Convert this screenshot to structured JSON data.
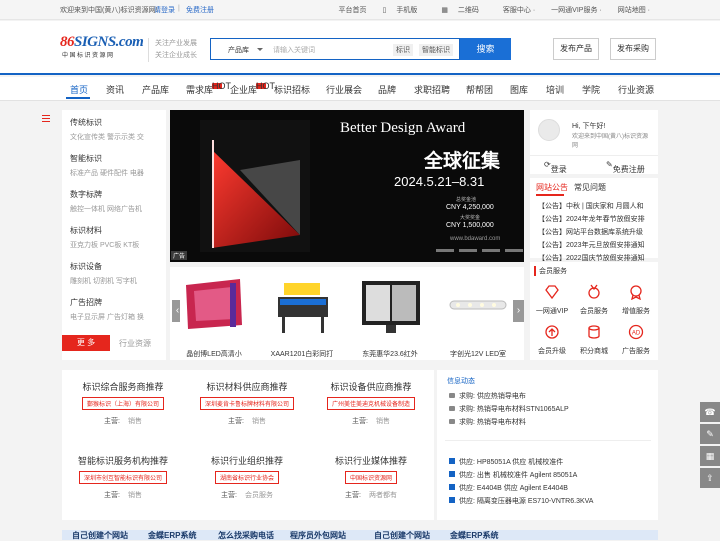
{
  "topbar": {
    "welcome": "欢迎来到中国(黄八)标识资源网!",
    "login": "请登录",
    "sep": "|",
    "register": "免费注册",
    "links": [
      "平台首页",
      "手机版",
      "二维码",
      "客服中心 ·",
      "一网通VIP服务 ·",
      "网站地图 ·"
    ]
  },
  "header": {
    "logo_text": "SIGNS.com",
    "logo_prefix": "86",
    "logo_sub": "中国标识资源网",
    "slogan": [
      "关注产业发展",
      "关注企业成长"
    ],
    "search": {
      "category": "产品库",
      "placeholder": "请输入关键词",
      "tag1": "标识",
      "tag2": "智能标识",
      "button": "搜索"
    },
    "publish_product": "发布产品",
    "publish_purchase": "发布采购"
  },
  "nav": {
    "items": [
      "首页",
      "资讯",
      "产品库",
      "需求库",
      "企业库",
      "标识招标",
      "行业展会",
      "品牌",
      "求职招聘",
      "帮帮团",
      "图库",
      "培训",
      "学院",
      "行业资源"
    ],
    "hot_label": "HOT"
  },
  "categories": {
    "groups": [
      {
        "title": "传统标识",
        "sub": "文化宣传类  警示示类  交"
      },
      {
        "title": "智能标识",
        "sub": "标准产品  硬件配件  电器"
      },
      {
        "title": "数字标牌",
        "sub": "触控一体机  网络广告机"
      },
      {
        "title": "标识材料",
        "sub": "亚克力板  PVC板  KT板"
      },
      {
        "title": "标识设备",
        "sub": "雕刻机  切割机  写字机"
      },
      {
        "title": "广告招牌",
        "sub": "电子显示屏  广告灯箱  换"
      }
    ],
    "more": "更  多",
    "resources": "行业资源"
  },
  "banner": {
    "line1": "Better Design Award",
    "line2": "全球征集",
    "line3": "2024.5.21–8.31",
    "prize1_label": "总奖金池",
    "prize1": "CNY 4,250,000",
    "prize2_label": "大奖奖金",
    "prize2": "CNY 1,500,000",
    "site": "www.bdaward.com",
    "ad": "广告"
  },
  "products": [
    {
      "caption": "晶创博LED高清小"
    },
    {
      "caption": "XAAR1201白彩同打"
    },
    {
      "caption": "东莞惠华23.6红外"
    },
    {
      "caption": "字创光12V LED室"
    }
  ],
  "user": {
    "greeting": "Hi, 下午好!",
    "welcome": "欢迎来到中国(黄八)标识资源网",
    "login": "登录",
    "register": "免费注册"
  },
  "notice": {
    "tab_active": "网站公告",
    "tab_other": "常见问题",
    "items": [
      "【公告】中秋 | 国庆家和 月圆人和",
      "【公告】2024年龙年春节放假安排",
      "【公告】网站平台数据库系统升级",
      "【公告】2023年元旦放假安排通知",
      "【公告】2022国庆节放假安排通知"
    ]
  },
  "member": {
    "title": "会员服务",
    "items": [
      "一网通VIP",
      "会员服务",
      "增值服务",
      "会员升级",
      "积分商城",
      "广告服务"
    ]
  },
  "reco": {
    "cols": [
      {
        "title": "标识综合服务商推荐",
        "tag": "鄞猴标识（上海）有限公司",
        "label": "主营:",
        "value": "销售"
      },
      {
        "title": "标识材料供应商推荐",
        "tag": "深圳麦肯卡鲁标牌材料有限公司",
        "label": "主营:",
        "value": "销售"
      },
      {
        "title": "标识设备供应商推荐",
        "tag": "广州美佳美迪克机械设备制造",
        "label": "主营:",
        "value": "销售"
      },
      {
        "title": "智能标识服务机构推荐",
        "tag": "深圳市创互智能标识有限公司",
        "label": "主营:",
        "value": "销售"
      },
      {
        "title": "标识行业组织推荐",
        "tag": "湖南省标识行业协会",
        "label": "主营:",
        "value": "会员服务"
      },
      {
        "title": "标识行业媒体推荐",
        "tag": "中国标识资源网",
        "label": "主营:",
        "value": "两者都有"
      }
    ]
  },
  "info": {
    "title": "信息动态",
    "demands": [
      "求购: 供应热销导电布",
      "求购: 热销导电布材料STN1065ALP",
      "求购: 热销导电布材料"
    ],
    "supplies": [
      "供应: HP85051A 供应 机械校准件",
      "供应: 出售 机械校准件 Agilent 85051A",
      "供应: E4404B 供应 Agilent E4404B",
      "供应: 隔离变压器电源 ES710-VNTR6.3KVA"
    ]
  },
  "bottom": [
    "自己创建个网站",
    "金蝶ERP系统",
    "怎么找采购电话",
    "程序员外包网站",
    "自己创建个网站",
    "金蝶ERP系统"
  ],
  "colors": {
    "brand": "#1463c4",
    "accent": "#e5261d"
  }
}
